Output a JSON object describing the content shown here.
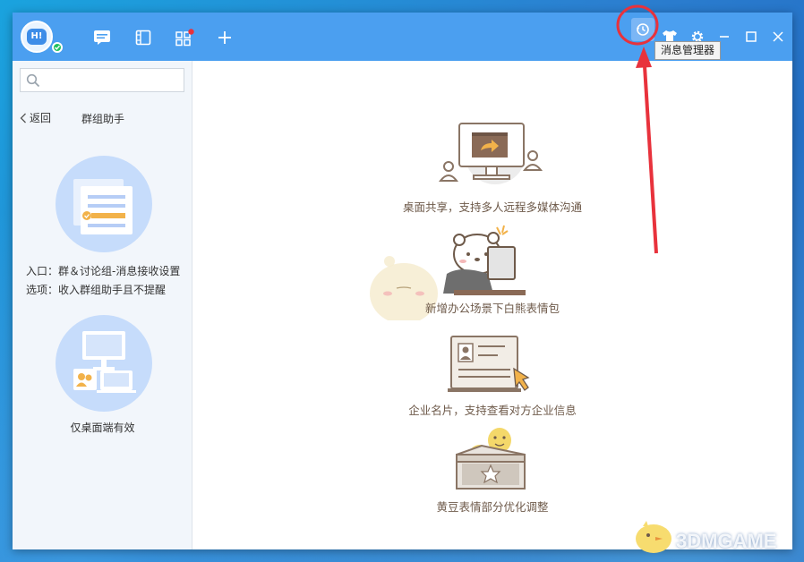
{
  "titlebar": {
    "avatar_text": "H!",
    "tooltip": "消息管理器"
  },
  "sidebar": {
    "search": {
      "placeholder": "",
      "value": ""
    },
    "back_label": "返回",
    "title": "群组助手",
    "entry_line": "入口：群＆讨论组-消息接收设置",
    "option_line": "选项：收入群组助手且不提醒",
    "desktop_only": "仅桌面端有效"
  },
  "features": [
    {
      "caption": "桌面共享，支持多人远程多媒体沟通",
      "icon": "screen-share-icon"
    },
    {
      "caption": "新增办公场景下白熊表情包",
      "icon": "white-bear-icon"
    },
    {
      "caption": "企业名片，支持查看对方企业信息",
      "icon": "business-card-icon"
    },
    {
      "caption": "黄豆表情部分优化调整",
      "icon": "yellow-bean-box-icon"
    }
  ],
  "watermark": "3DMGAME",
  "colors": {
    "titlebar": "#4b9ff0",
    "sidebar_bg": "#f2f6fb",
    "accent_red": "#e8323c",
    "caption_brown": "#6e5a4a"
  }
}
